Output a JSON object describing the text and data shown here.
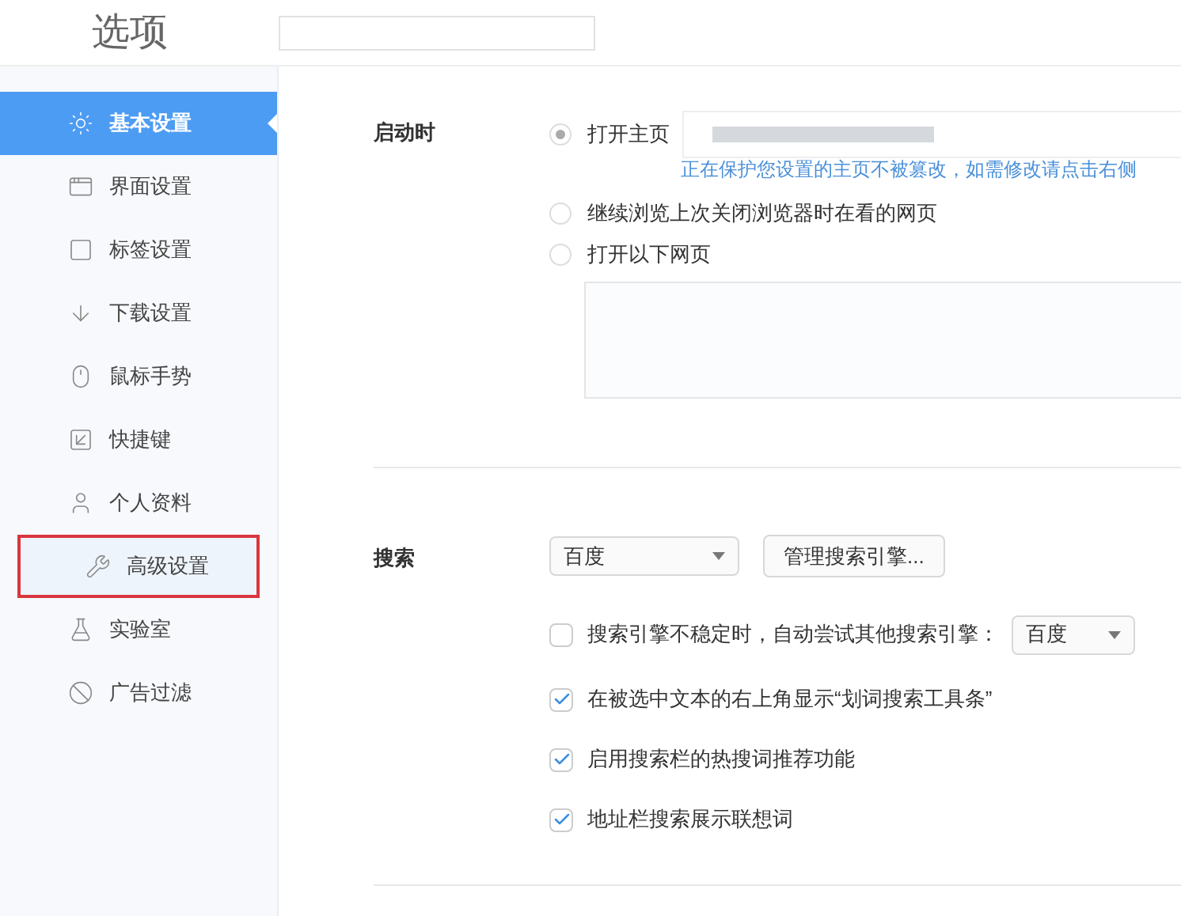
{
  "header": {
    "title": "选项"
  },
  "sidebar": {
    "items": [
      {
        "label": "基本设置",
        "selected": true,
        "highlighted": false
      },
      {
        "label": "界面设置",
        "selected": false,
        "highlighted": false
      },
      {
        "label": "标签设置",
        "selected": false,
        "highlighted": false
      },
      {
        "label": "下载设置",
        "selected": false,
        "highlighted": false
      },
      {
        "label": "鼠标手势",
        "selected": false,
        "highlighted": false
      },
      {
        "label": "快捷键",
        "selected": false,
        "highlighted": false
      },
      {
        "label": "个人资料",
        "selected": false,
        "highlighted": false
      },
      {
        "label": "高级设置",
        "selected": false,
        "highlighted": true
      },
      {
        "label": "实验室",
        "selected": false,
        "highlighted": false
      },
      {
        "label": "广告过滤",
        "selected": false,
        "highlighted": false
      }
    ]
  },
  "startup": {
    "label": "启动时",
    "options": [
      {
        "label": "打开主页",
        "selected": true,
        "kind": "homepage",
        "hint": "正在保护您设置的主页不被篡改，如需修改请点击右侧"
      },
      {
        "label": "继续浏览上次关闭浏览器时在看的网页",
        "selected": false,
        "kind": "plain"
      },
      {
        "label": "打开以下网页",
        "selected": false,
        "kind": "pages"
      }
    ]
  },
  "search": {
    "label": "搜索",
    "engine": "百度",
    "manage_button": "管理搜索引擎...",
    "options": [
      {
        "label": "搜索引擎不稳定时，自动尝试其他搜索引擎：",
        "checked": false,
        "kind": "fallback",
        "engine": "百度"
      },
      {
        "label": "在被选中文本的右上角显示“划词搜索工具条”",
        "checked": true,
        "kind": "plain"
      },
      {
        "label": "启用搜索栏的热搜词推荐功能",
        "checked": true,
        "kind": "plain"
      },
      {
        "label": "地址栏搜索展示联想词",
        "checked": true,
        "kind": "plain"
      }
    ]
  }
}
